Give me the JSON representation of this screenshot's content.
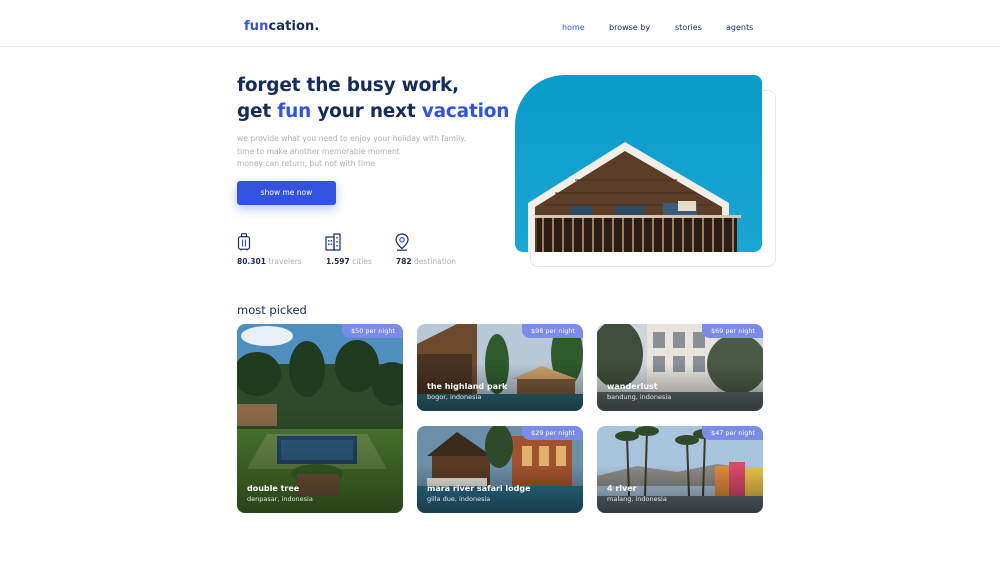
{
  "header": {
    "logo_a": "fun",
    "logo_b": "cation.",
    "nav": [
      "home",
      "browse by",
      "stories",
      "agents"
    ]
  },
  "hero": {
    "title_line1": "forget the busy work,",
    "title_line2_a": "get ",
    "title_line2_b": "fun",
    "title_line2_c": " your next ",
    "title_line2_d": "vacation",
    "desc": [
      "we provide what you need to enjoy your holiday with family.",
      "time to make another memorable moment",
      "money can return, but not with time"
    ],
    "cta": "show me now",
    "stats": [
      {
        "icon": "luggage-icon",
        "value": "80.301",
        "label": " travelers"
      },
      {
        "icon": "city-icon",
        "value": "1.597",
        "label": " cities"
      },
      {
        "icon": "location-pin-icon",
        "value": "782",
        "label": " destination"
      }
    ]
  },
  "most_picked": {
    "title": "most picked",
    "cards": [
      {
        "name": "double tree",
        "location": "denpasar, indonesia",
        "price": "$50 per night"
      },
      {
        "name": "the highland park",
        "location": "bogor, indonesia",
        "price": "$98 per night"
      },
      {
        "name": "wanderlust",
        "location": "bandung, indonesia",
        "price": "$69 per night"
      },
      {
        "name": "mara river safari lodge",
        "location": "gilla due, indonesia",
        "price": "$29 per night"
      },
      {
        "name": "4 river",
        "location": "malang, indonesia",
        "price": "$47 per night"
      }
    ]
  },
  "colors": {
    "primary": "#3252df",
    "dark": "#152c5b",
    "muted": "#b0b0b0",
    "price_badge": "#7a8be8"
  }
}
